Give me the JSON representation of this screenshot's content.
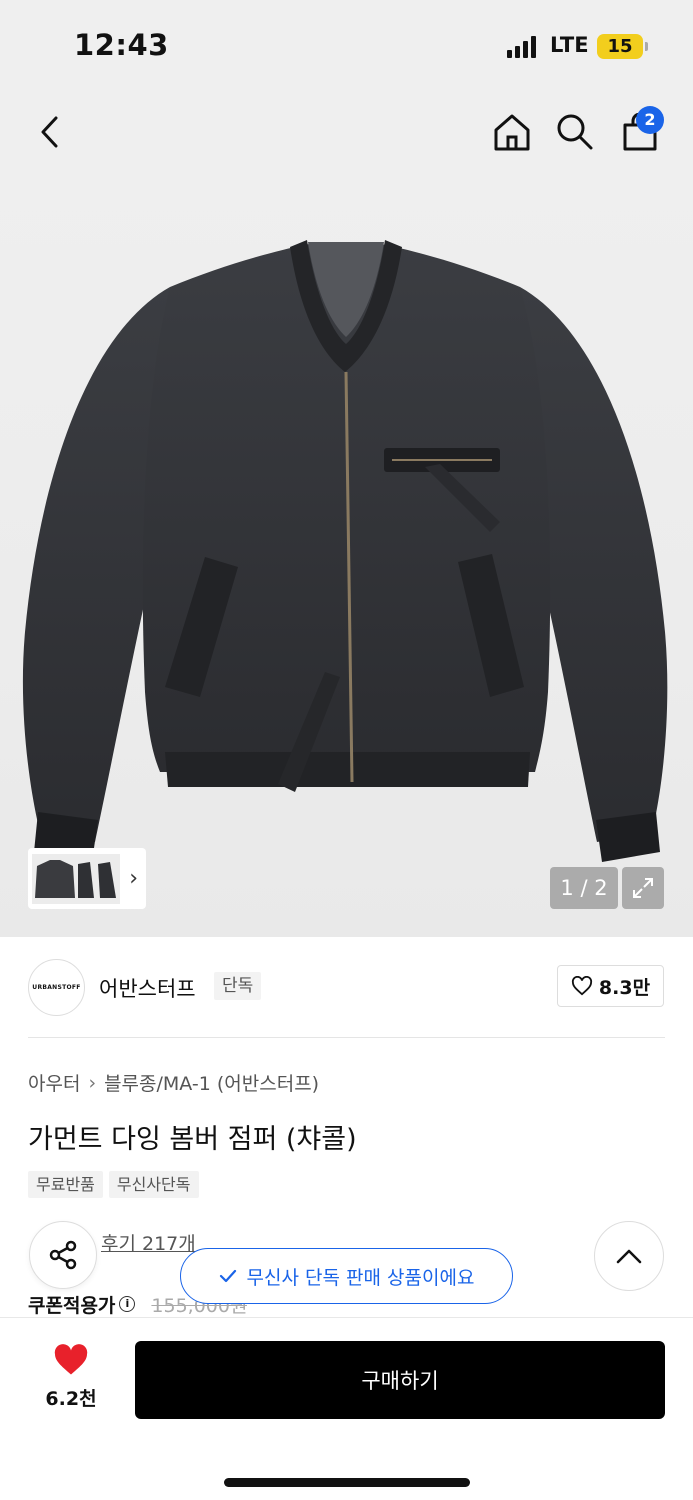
{
  "status": {
    "time": "12:43",
    "network": "LTE",
    "battery": "15"
  },
  "header": {
    "cart_count": "2"
  },
  "gallery": {
    "page_indicator": "1 / 2"
  },
  "brand": {
    "logo_text": "URBANSTOFF",
    "name": "어반스터프",
    "tag": "단독",
    "likes": "8.3만"
  },
  "product": {
    "breadcrumb": [
      "아우터",
      "블루종/MA-1 (어반스터프)"
    ],
    "title": "가먼트 다잉 봄버 점퍼 (챠콜)",
    "chips": [
      "무료반품",
      "무신사단독"
    ],
    "review": "후기 217개",
    "coupon_label": "쿠폰적용가",
    "original_price": "155,000원"
  },
  "toast": {
    "text": "무신사 단독 판매 상품이에요"
  },
  "bottom": {
    "wish_count": "6.2천",
    "buy_label": "구매하기"
  },
  "colors": {
    "accent": "#1a64e8",
    "heart": "#e8212b",
    "button": "#000000"
  }
}
